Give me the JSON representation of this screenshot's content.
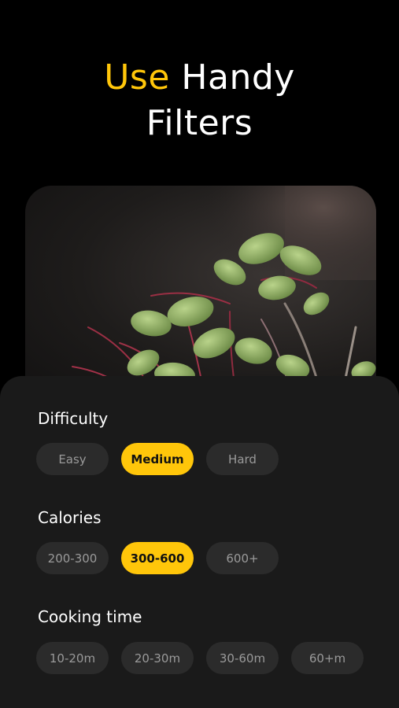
{
  "headline": {
    "accent_word": "Use",
    "line1_rest": "Handy",
    "line2": "Filters"
  },
  "colors": {
    "accent": "#FFC60A",
    "background": "#000000",
    "sheet": "#1A1A1A",
    "chip": "#2B2B2B",
    "chip_text": "#9A9A9A"
  },
  "photo": {
    "subject": "microgreens-closeup"
  },
  "filters": {
    "difficulty": {
      "title": "Difficulty",
      "options": [
        "Easy",
        "Medium",
        "Hard"
      ],
      "selected": "Medium"
    },
    "calories": {
      "title": "Calories",
      "options": [
        "200-300",
        "300-600",
        "600+"
      ],
      "selected": "300-600"
    },
    "cooking_time": {
      "title": "Cooking time",
      "options": [
        "10-20m",
        "20-30m",
        "30-60m",
        "60+m"
      ],
      "selected": null
    }
  }
}
